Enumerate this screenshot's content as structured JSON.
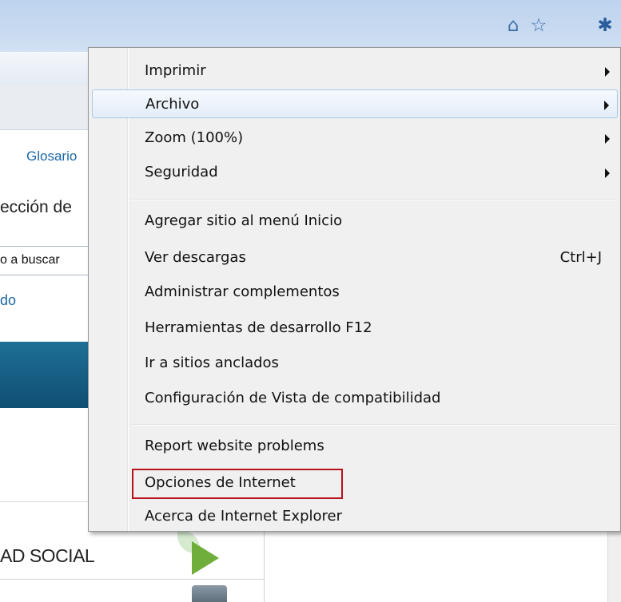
{
  "toolbar": {
    "icons": [
      "home-icon",
      "star-icon",
      "gear-icon"
    ],
    "icon_glyphs": {
      "home": "⌂",
      "star": "☆",
      "gear": "✱"
    }
  },
  "background_page": {
    "glosario": "Glosario",
    "seccion": "ección de",
    "buscar": "o a buscar",
    "do_link": "do",
    "social": "AD SOCIAL"
  },
  "menu": {
    "items": [
      {
        "label": "Imprimir",
        "submenu": true
      },
      {
        "label": "Archivo",
        "submenu": true,
        "highlighted": true
      },
      {
        "label": "Zoom (100%)",
        "submenu": true
      },
      {
        "label": "Seguridad",
        "submenu": true
      },
      {
        "label": "Agregar sitio al menú Inicio"
      },
      {
        "label": "Ver descargas",
        "shortcut": "Ctrl+J"
      },
      {
        "label": "Administrar complementos"
      },
      {
        "label": "Herramientas de desarrollo F12"
      },
      {
        "label": "Ir a sitios anclados"
      },
      {
        "label": "Configuración de Vista de compatibilidad"
      },
      {
        "label": "Report website problems"
      },
      {
        "label": "Opciones de Internet",
        "annotated": true
      },
      {
        "label": "Acerca de Internet Explorer"
      }
    ]
  },
  "colors": {
    "annotation_box": "#b5121b",
    "link": "#1a66a6",
    "highlight_border": "#a8c8ea"
  }
}
